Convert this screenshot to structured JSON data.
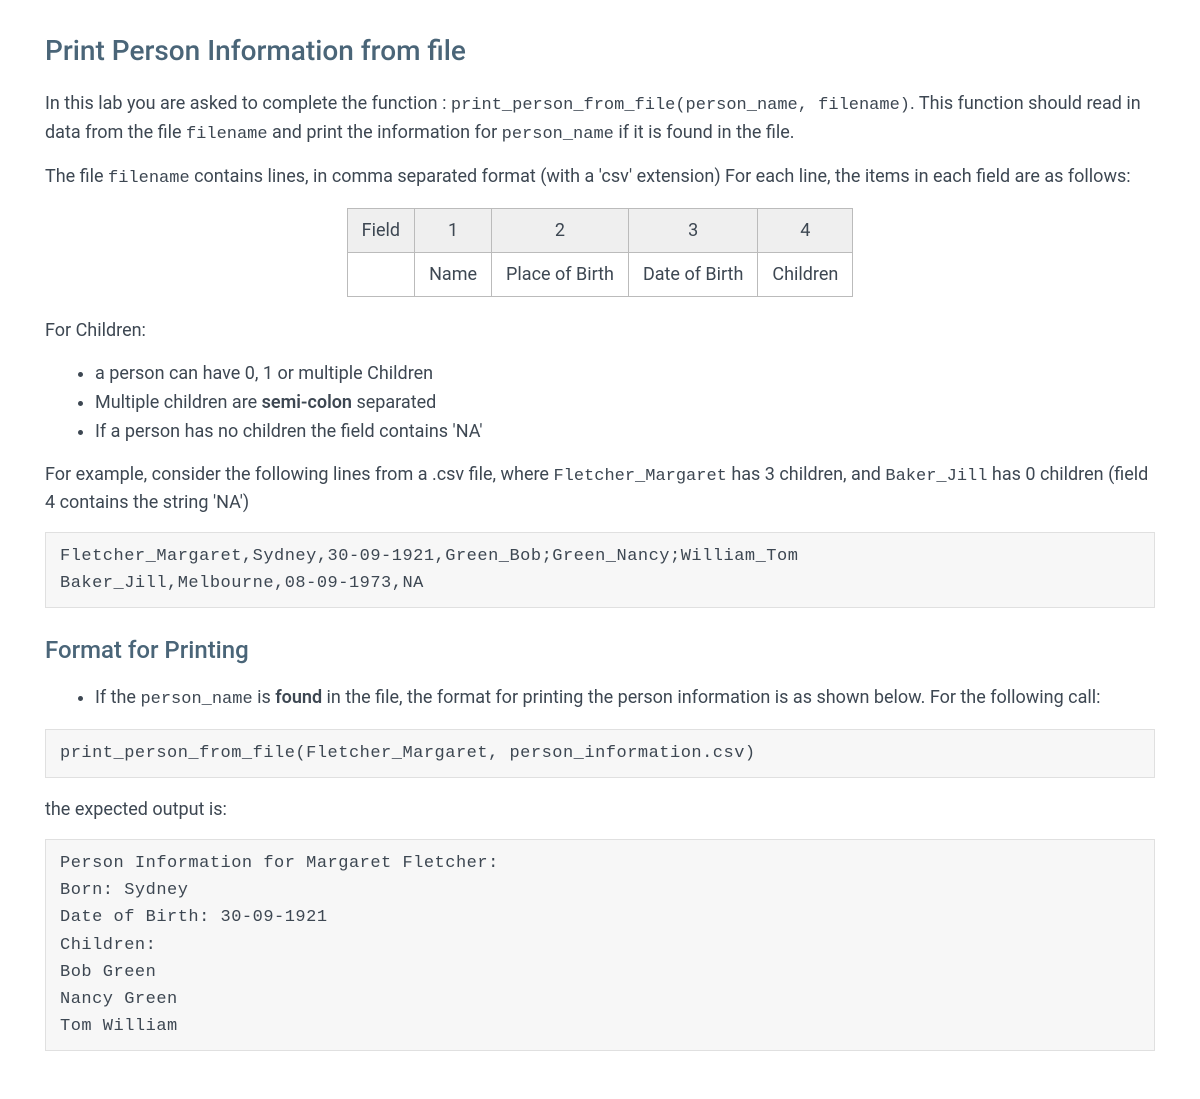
{
  "heading1": "Print Person Information from file",
  "para1_part1": "In this lab you are asked to complete the function : ",
  "para1_code1": "print_person_from_file(person_name, filename)",
  "para1_part2": ". This function should read in data from the file ",
  "para1_code2": "filename",
  "para1_part3": " and print the information for ",
  "para1_code3": "person_name",
  "para1_part4": " if it is found in the file.",
  "para2_part1": "The file ",
  "para2_code1": "filename",
  "para2_part2": " contains lines, in comma separated format (with a 'csv' extension) For each line, the items in each field are as follows:",
  "table": {
    "row1": [
      "Field",
      "1",
      "2",
      "3",
      "4"
    ],
    "row2": [
      "",
      "Name",
      "Place of Birth",
      "Date of Birth",
      "Children"
    ]
  },
  "para3": "For Children:",
  "children_bullets": {
    "b1": "a person can have 0, 1 or multiple Children",
    "b2_part1": "Multiple children are ",
    "b2_bold": "semi-colon",
    "b2_part2": " separated",
    "b3": "If a person has no children the field contains 'NA'"
  },
  "para4_part1": "For example, consider the following lines from a .csv file, where ",
  "para4_code1": "Fletcher_Margaret",
  "para4_part2": " has 3 children, and ",
  "para4_code2": "Baker_Jill",
  "para4_part3": " has 0 children (field 4 contains the string 'NA')",
  "codeblock1": "Fletcher_Margaret,Sydney,30-09-1921,Green_Bob;Green_Nancy;William_Tom\nBaker_Jill,Melbourne,08-09-1973,NA",
  "heading2": "Format for Printing",
  "format_bullets": {
    "b1_part1": "If the ",
    "b1_code1": "person_name",
    "b1_part2": " is ",
    "b1_bold": "found",
    "b1_part3": " in the file, the format for printing the person information is as shown below. For the following call:"
  },
  "codeblock2": "print_person_from_file(Fletcher_Margaret, person_information.csv)",
  "para5": "the expected output is:",
  "codeblock3": "Person Information for Margaret Fletcher:\nBorn: Sydney\nDate of Birth: 30-09-1921\nChildren:\nBob Green\nNancy Green\nTom William"
}
